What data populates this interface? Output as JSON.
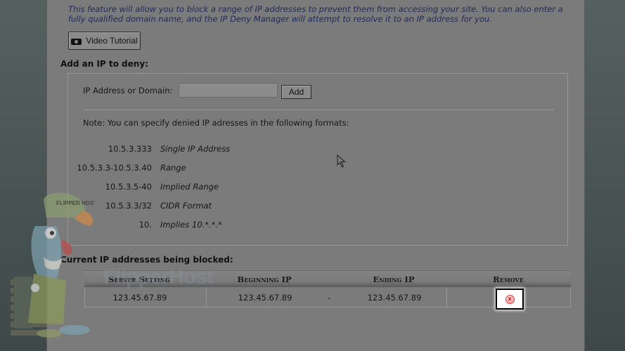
{
  "intro_text": "This feature will allow you to block a range of IP addresses to prevent them from accessing your site. You can also enter a fully qualified domain name, and the IP Deny Manager will attempt to resolve it to an IP address for you.",
  "video_button_label": "Video Tutorial",
  "add_section": {
    "title": "Add an IP to deny:",
    "field_label": "IP Address or Domain:",
    "field_value": "",
    "add_label": "Add",
    "note": "Note: You can specify denied IP adresses in the following formats:",
    "formats": [
      {
        "example": "10.5.3.333",
        "description": "Single IP Address"
      },
      {
        "example": "10.5.3.3-10.5.3.40",
        "description": "Range"
      },
      {
        "example": "10.5.3.5-40",
        "description": "Implied Range"
      },
      {
        "example": "10.5.3.3/32",
        "description": "CIDR Format"
      },
      {
        "example": "10.",
        "description": "Implies 10.*.*.*"
      }
    ]
  },
  "blocked_section": {
    "title": "Current IP addresses being blocked:",
    "columns": [
      "Server Setting",
      "Beginning IP",
      "Ending IP",
      "Remove"
    ],
    "rows": [
      {
        "server_setting": "123.45.67.89",
        "beginning_ip": "123.45.67.89",
        "separator": "-",
        "ending_ip": "123.45.67.89"
      }
    ]
  },
  "mascot": {
    "cap_text": "FLIPPER HOST",
    "watermark": "FlipperHost"
  },
  "icons": {
    "remove": "remove-x-icon",
    "video": "camera-icon",
    "cursor": "mouse-pointer-icon"
  },
  "colors": {
    "panel": "#7b7b7b",
    "intro_text": "#1f2a5a",
    "remove_icon": "#e23a3a"
  }
}
